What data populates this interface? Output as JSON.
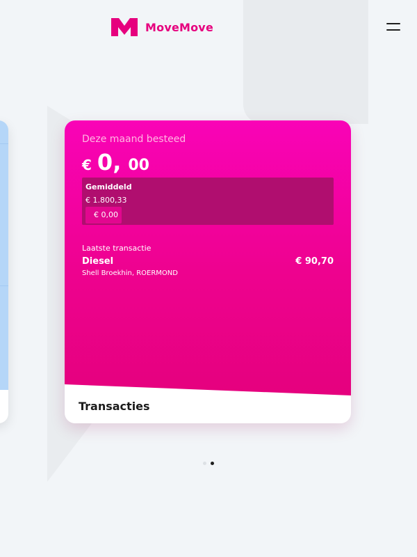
{
  "header": {
    "brand": "MoveMove",
    "logo_icon": "movemove-m-logo",
    "menu_icon": "hamburger-menu-icon",
    "brand_color": "#e6007e"
  },
  "card": {
    "spent_label": "Deze maand besteed",
    "spent_currency": "€",
    "spent_int": "0,",
    "spent_dec": "00",
    "average_label": "Gemiddeld",
    "average_value": "€ 1.800,33",
    "current_value": "€ 0,00",
    "last_transaction_label": "Laatste transactie",
    "last_transaction_name": "Diesel",
    "last_transaction_place": "Shell Broekhin, ROERMOND",
    "last_transaction_amount": "€ 90,70",
    "footer_label": "Transacties",
    "colors": {
      "pink": "#f903b7",
      "deep_pink": "#e5017e",
      "average_box": "#b00e6f"
    }
  },
  "pager": {
    "pages": 2,
    "active_index": 1
  }
}
